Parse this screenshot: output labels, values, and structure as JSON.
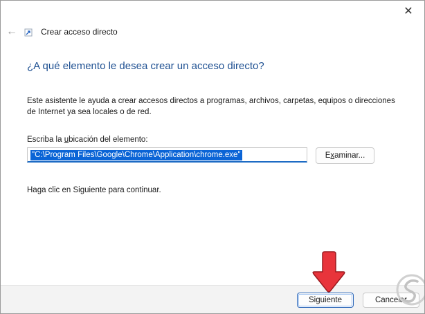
{
  "window": {
    "title": "Crear acceso directo",
    "close_icon": "close-icon",
    "back_icon": "back-arrow-icon"
  },
  "content": {
    "heading": "¿A qué elemento le desea crear un acceso directo?",
    "description": "Este asistente le ayuda a crear accesos directos a programas, archivos, carpetas, equipos o direcciones de Internet ya sea locales o de red.",
    "location_label_pre": "Escriba la ",
    "location_label_accel": "u",
    "location_label_post": "bicación del elemento:",
    "location_value": "\"C:\\Program Files\\Google\\Chrome\\Application\\chrome.exe\"",
    "browse_pre": "E",
    "browse_accel": "x",
    "browse_post": "aminar...",
    "continue_text": "Haga clic en Siguiente para continuar."
  },
  "footer": {
    "next_pre": "Si",
    "next_accel": "g",
    "next_post": "uiente",
    "cancel_label": "Cancelar"
  },
  "colors": {
    "heading": "#1d4f91",
    "selection": "#0a64d6",
    "arrow": "#e8343b",
    "focus": "#2b66b8"
  }
}
